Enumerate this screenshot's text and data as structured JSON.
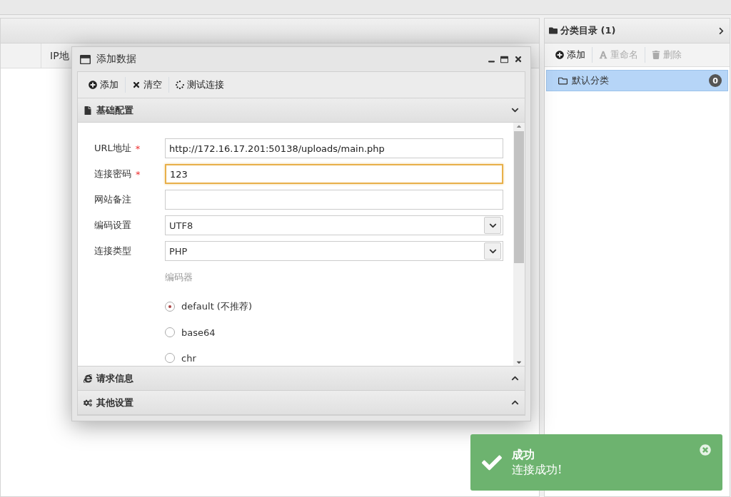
{
  "grid": {
    "columns": [
      "IP地"
    ]
  },
  "category_panel": {
    "title": "分类目录 (1)",
    "toolbar": [
      {
        "kind": "add",
        "label": "添加",
        "disabled": false
      },
      {
        "kind": "rename",
        "label": "重命名",
        "disabled": true
      },
      {
        "kind": "delete",
        "label": "删除",
        "disabled": true
      }
    ],
    "items": [
      {
        "label": "默认分类",
        "count": "0",
        "selected": true
      }
    ]
  },
  "dialog": {
    "title": "添加数据",
    "toolbar": [
      {
        "kind": "add",
        "label": "添加"
      },
      {
        "kind": "clear",
        "label": "清空"
      },
      {
        "kind": "test",
        "label": "测试连接"
      }
    ],
    "sections": [
      {
        "kind": "basic",
        "title": "基础配置",
        "expanded": true,
        "fields": [
          {
            "kind": "text",
            "label": "URL地址",
            "required_mark": "*",
            "focused": false,
            "value": "http://172.16.17.201:50138/uploads/main.php"
          },
          {
            "kind": "text",
            "label": "连接密码",
            "required_mark": "*",
            "focused": true,
            "value": "123"
          },
          {
            "kind": "text",
            "label": "网站备注",
            "focused": false
          },
          {
            "kind": "select",
            "label": "编码设置",
            "value": "UTF8"
          },
          {
            "kind": "select",
            "label": "连接类型",
            "value": "PHP"
          }
        ],
        "encoder": {
          "label": "编码器",
          "options": [
            {
              "label": "default (不推荐)",
              "selected": true
            },
            {
              "label": "base64",
              "selected": false
            },
            {
              "label": "chr",
              "selected": false
            }
          ]
        }
      },
      {
        "kind": "request",
        "title": "请求信息",
        "expanded": false
      },
      {
        "kind": "other",
        "title": "其他设置",
        "expanded": false
      }
    ]
  },
  "toast": {
    "title": "成功",
    "message": "连接成功!"
  }
}
